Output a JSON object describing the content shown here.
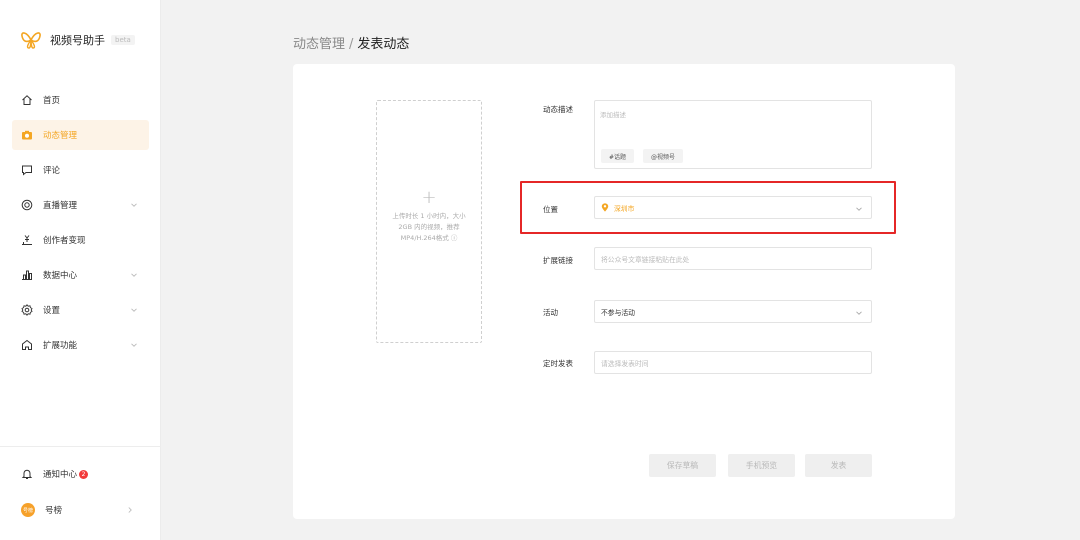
{
  "brand": {
    "title": "视频号助手",
    "beta": "beta",
    "logo_icon": "butterfly-logo",
    "accent": "#f4a623"
  },
  "sidebar": {
    "items": [
      {
        "label": "首页",
        "icon": "home-icon",
        "active": false,
        "chevron": false
      },
      {
        "label": "动态管理",
        "icon": "camera-icon",
        "active": true,
        "chevron": false
      },
      {
        "label": "评论",
        "icon": "comment-icon",
        "active": false,
        "chevron": false
      },
      {
        "label": "直播管理",
        "icon": "live-icon",
        "active": false,
        "chevron": true
      },
      {
        "label": "创作者变现",
        "icon": "money-icon",
        "active": false,
        "chevron": false
      },
      {
        "label": "数据中心",
        "icon": "chart-icon",
        "active": false,
        "chevron": true
      },
      {
        "label": "设置",
        "icon": "gear-icon",
        "active": false,
        "chevron": true
      },
      {
        "label": "扩展功能",
        "icon": "extension-icon",
        "active": false,
        "chevron": true
      }
    ],
    "notice": {
      "label": "通知中心",
      "badge": "2"
    },
    "account": {
      "name": "号榜",
      "avatar_text": "号榜"
    }
  },
  "breadcrumb": {
    "parent": "动态管理",
    "separator": "/",
    "current": "发表动态"
  },
  "upload": {
    "plus": "+",
    "hint": "上传时长 1 小时内，大小 2GB 内的视频，推荐MP4/H.264格式 ⓘ"
  },
  "form": {
    "desc": {
      "label": "动态描述",
      "placeholder": "添加描述",
      "tags": [
        "#话题",
        "@视频号"
      ]
    },
    "location": {
      "label": "位置",
      "value": "深圳市"
    },
    "link": {
      "label": "扩展链接",
      "placeholder": "将公众号文章链接粘贴在此处"
    },
    "activity": {
      "label": "活动",
      "value": "不参与活动"
    },
    "schedule": {
      "label": "定时发表",
      "placeholder": "请选择发表时间"
    }
  },
  "actions": {
    "save_draft": "保存草稿",
    "preview": "手机预览",
    "publish": "发表"
  },
  "colors": {
    "highlight": "#e52727",
    "active_bg": "#fdf3e7"
  }
}
